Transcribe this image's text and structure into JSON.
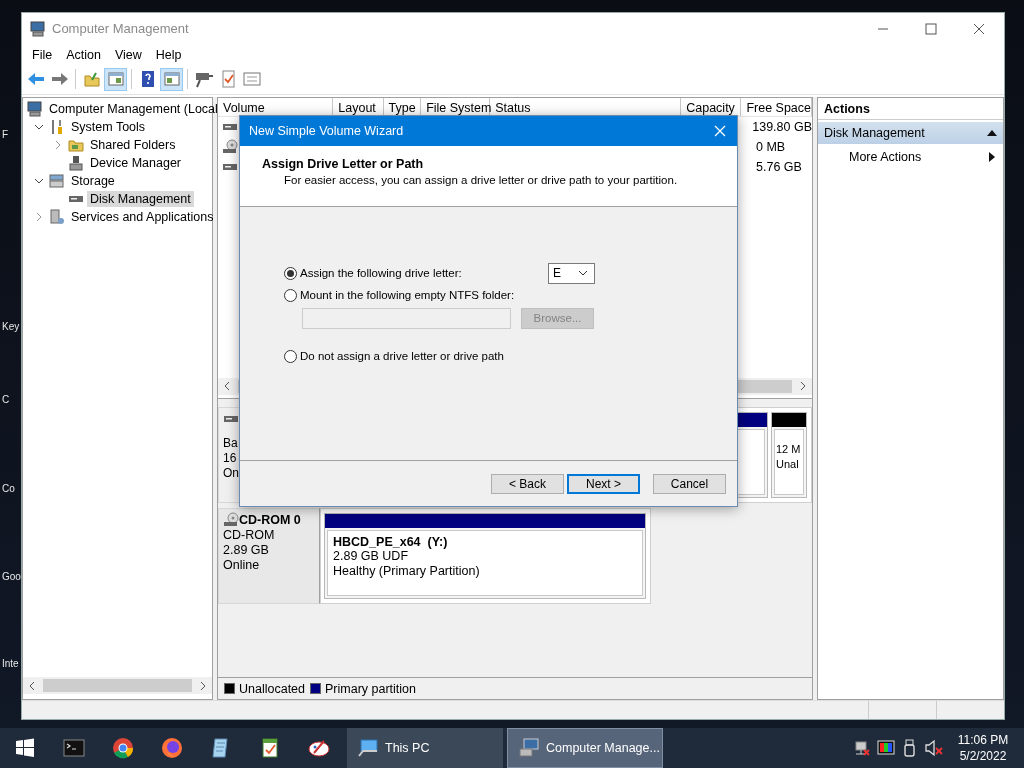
{
  "desktop_labels": [
    "F",
    "Key",
    "C",
    "Co",
    "Goo",
    "Inte"
  ],
  "window": {
    "title": "Computer Management"
  },
  "menu": [
    "File",
    "Action",
    "View",
    "Help"
  ],
  "toolbar": [
    {
      "kind": "back",
      "pressed": false
    },
    {
      "kind": "forward",
      "pressed": false
    },
    {
      "kind": "up",
      "pressed": false
    },
    {
      "kind": "pane",
      "pressed": true
    },
    {
      "kind": "help",
      "pressed": false
    },
    {
      "kind": "pane2",
      "pressed": true
    },
    {
      "kind": "connect",
      "pressed": false
    },
    {
      "kind": "check",
      "pressed": false
    },
    {
      "kind": "list",
      "pressed": false
    }
  ],
  "tree": [
    {
      "kind": "computer",
      "label": "Computer Management (Local",
      "selected": false,
      "children": [
        {
          "kind": "tools",
          "label": "System Tools",
          "expanded": true,
          "selected": false,
          "children": [
            {
              "kind": "share",
              "label": "Shared Folders",
              "expanded": false,
              "selected": false
            },
            {
              "kind": "device",
              "label": "Device Manager",
              "selected": false
            }
          ]
        },
        {
          "kind": "storage",
          "label": "Storage",
          "expanded": true,
          "selected": false,
          "children": [
            {
              "kind": "disk",
              "label": "Disk Management",
              "selected": true
            }
          ]
        },
        {
          "kind": "services",
          "label": "Services and Applications",
          "expanded": false,
          "selected": false
        }
      ]
    }
  ],
  "table": {
    "columns": [
      "Volume",
      "Layout",
      "Type",
      "File System",
      "Status",
      "Capacity",
      "Free Space"
    ],
    "rows": [
      {
        "kind": "disk",
        "free_space": "139.80 GB"
      },
      {
        "kind": "cd",
        "free_space": "0 MB"
      },
      {
        "kind": "disk",
        "free_space": "5.76 GB"
      }
    ]
  },
  "disks": [
    {
      "kind": "disk",
      "lines": [
        "Ba",
        "16",
        "On"
      ],
      "partitions": [
        {
          "kind": "primary",
          "color": "#000080"
        },
        {
          "kind": "unallocated",
          "color": "#000000",
          "lines": [
            "12 M",
            "Unal"
          ]
        }
      ]
    },
    {
      "kind": "cd",
      "title": "CD-ROM 0",
      "lines": [
        "CD-ROM",
        "2.89 GB",
        "Online"
      ],
      "partitions": [
        {
          "kind": "primary",
          "color": "#000080",
          "label": "HBCD_PE_x64  (Y:)",
          "lines": [
            "2.89 GB UDF",
            "Healthy (Primary Partition)"
          ]
        }
      ]
    }
  ],
  "legend": [
    {
      "label": "Unallocated",
      "color": "#000000"
    },
    {
      "label": "Primary partition",
      "color": "#000080"
    }
  ],
  "actions": {
    "title": "Actions",
    "items": [
      {
        "kind": "group",
        "label": "Disk Management",
        "expanded": true,
        "selected": true
      },
      {
        "kind": "submenu",
        "label": "More Actions",
        "selected": false
      }
    ]
  },
  "dialog": {
    "title": "New Simple Volume Wizard",
    "heading": "Assign Drive Letter or Path",
    "subtitle": "For easier access, you can assign a drive letter or drive path to your partition.",
    "options": [
      {
        "kind": "letter",
        "label": "Assign the following drive letter:",
        "selected": true,
        "value": "E"
      },
      {
        "kind": "folder",
        "label": "Mount in the following empty NTFS folder:",
        "selected": false,
        "button": "Browse..."
      },
      {
        "kind": "none",
        "label": "Do not assign a drive letter or drive path",
        "selected": false
      }
    ],
    "buttons": [
      {
        "label": "< Back",
        "focused": false
      },
      {
        "label": "Next >",
        "focused": true
      },
      {
        "label": "Cancel",
        "focused": false
      }
    ]
  },
  "taskbar": {
    "pinned": [
      {
        "kind": "terminal"
      },
      {
        "kind": "browser"
      },
      {
        "kind": "fox"
      },
      {
        "kind": "notepad"
      },
      {
        "kind": "document"
      },
      {
        "kind": "paint"
      }
    ],
    "windows": [
      {
        "kind": "computer",
        "label": "This PC",
        "selected": false
      },
      {
        "kind": "management",
        "label": "Computer Manage...",
        "selected": true
      }
    ],
    "tray": [
      {
        "kind": "network"
      },
      {
        "kind": "display"
      },
      {
        "kind": "usb"
      },
      {
        "kind": "volume"
      }
    ],
    "time": "11:06 PM",
    "date": "5/2/2022"
  }
}
